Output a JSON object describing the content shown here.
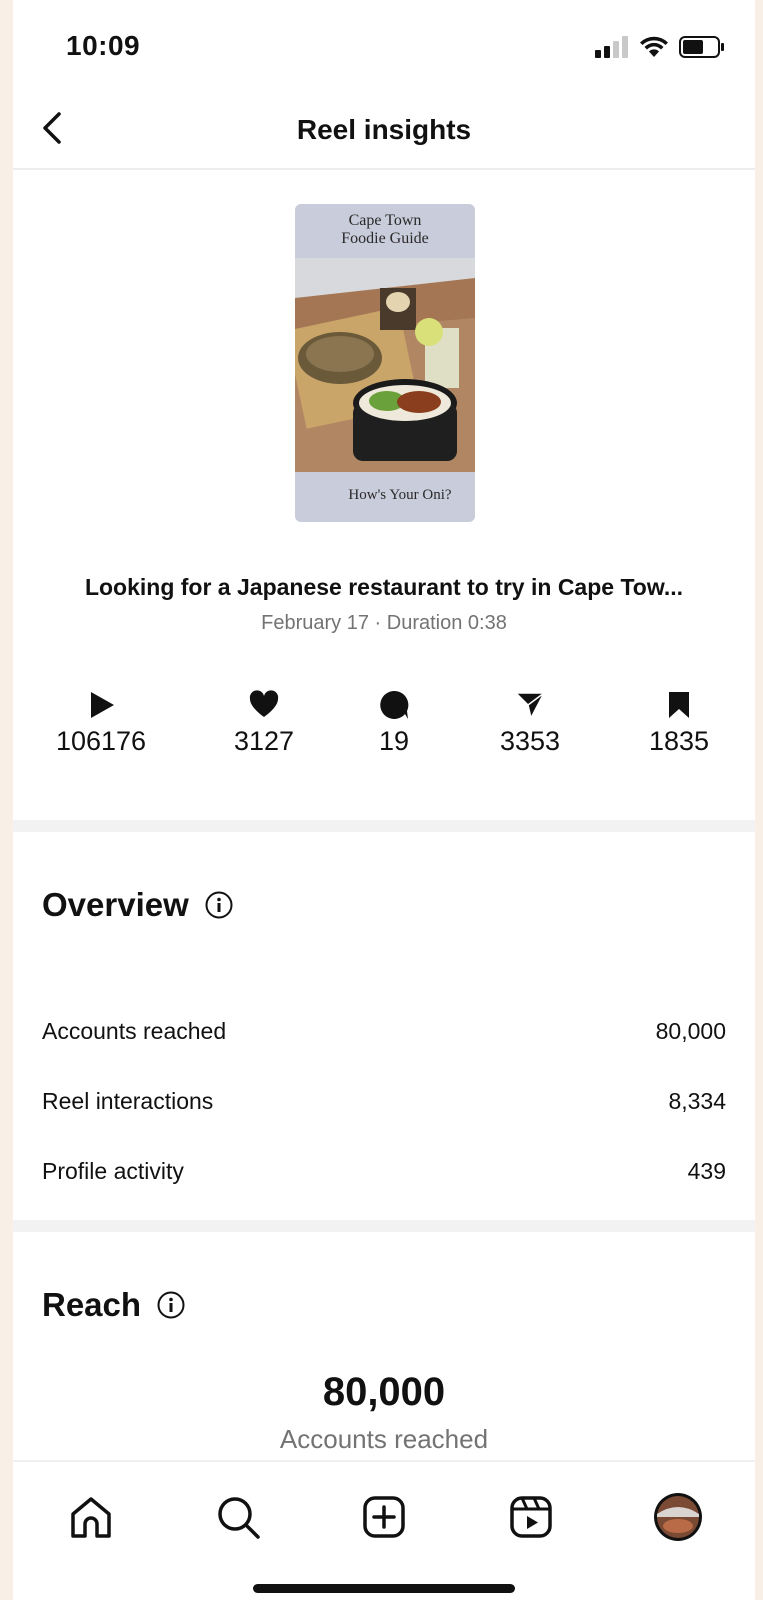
{
  "status_bar": {
    "time": "10:09"
  },
  "header": {
    "title": "Reel insights"
  },
  "thumbnail": {
    "top_text": [
      "Cape Town",
      "Foodie Guide"
    ],
    "bottom_text": "How's Your Oni?"
  },
  "reel": {
    "caption": "Looking for a Japanese restaurant to try in Cape Tow...",
    "meta": "February 17 · Duration 0:38"
  },
  "stats": [
    {
      "icon": "play-icon",
      "value": "106176"
    },
    {
      "icon": "heart-icon",
      "value": "3127"
    },
    {
      "icon": "comment-icon",
      "value": "19"
    },
    {
      "icon": "share-icon",
      "value": "3353"
    },
    {
      "icon": "bookmark-icon",
      "value": "1835"
    }
  ],
  "overview": {
    "title": "Overview",
    "rows": [
      {
        "label": "Accounts reached",
        "value": "80,000"
      },
      {
        "label": "Reel interactions",
        "value": "8,334"
      },
      {
        "label": "Profile activity",
        "value": "439"
      }
    ]
  },
  "reach": {
    "title": "Reach",
    "value": "80,000",
    "label": "Accounts reached"
  },
  "nav": [
    "home-icon",
    "search-icon",
    "create-icon",
    "reels-icon",
    "profile-avatar"
  ]
}
